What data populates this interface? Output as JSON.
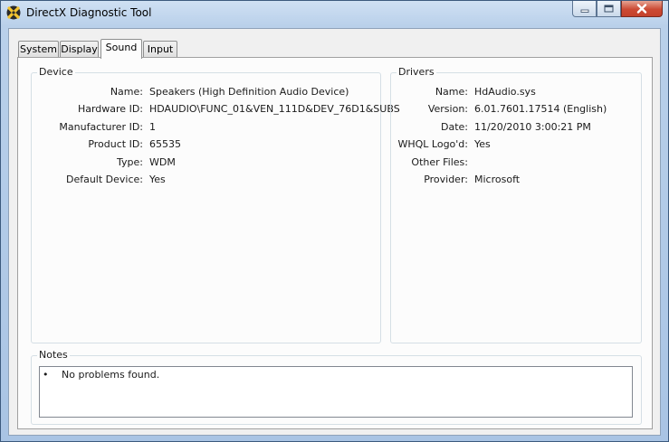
{
  "window": {
    "title": "DirectX Diagnostic Tool",
    "icon": "directx-icon"
  },
  "tabs": [
    {
      "label": "System",
      "active": false
    },
    {
      "label": "Display",
      "active": false
    },
    {
      "label": "Sound",
      "active": true
    },
    {
      "label": "Input",
      "active": false
    }
  ],
  "device": {
    "heading": "Device",
    "fields": [
      {
        "label": "Name:",
        "value": "Speakers (High Definition Audio Device)"
      },
      {
        "label": "Hardware ID:",
        "value": "HDAUDIO\\FUNC_01&VEN_111D&DEV_76D1&SUBS"
      },
      {
        "label": "Manufacturer ID:",
        "value": "1"
      },
      {
        "label": "Product ID:",
        "value": "65535"
      },
      {
        "label": "Type:",
        "value": "WDM"
      },
      {
        "label": "Default Device:",
        "value": "Yes"
      }
    ]
  },
  "drivers": {
    "heading": "Drivers",
    "fields": [
      {
        "label": "Name:",
        "value": "HdAudio.sys"
      },
      {
        "label": "Version:",
        "value": "6.01.7601.17514 (English)"
      },
      {
        "label": "Date:",
        "value": "11/20/2010 3:00:21 PM"
      },
      {
        "label": "WHQL Logo'd:",
        "value": "Yes"
      },
      {
        "label": "Other Files:",
        "value": ""
      },
      {
        "label": "Provider:",
        "value": "Microsoft"
      }
    ]
  },
  "notes": {
    "heading": "Notes",
    "items": [
      "No problems found."
    ]
  }
}
